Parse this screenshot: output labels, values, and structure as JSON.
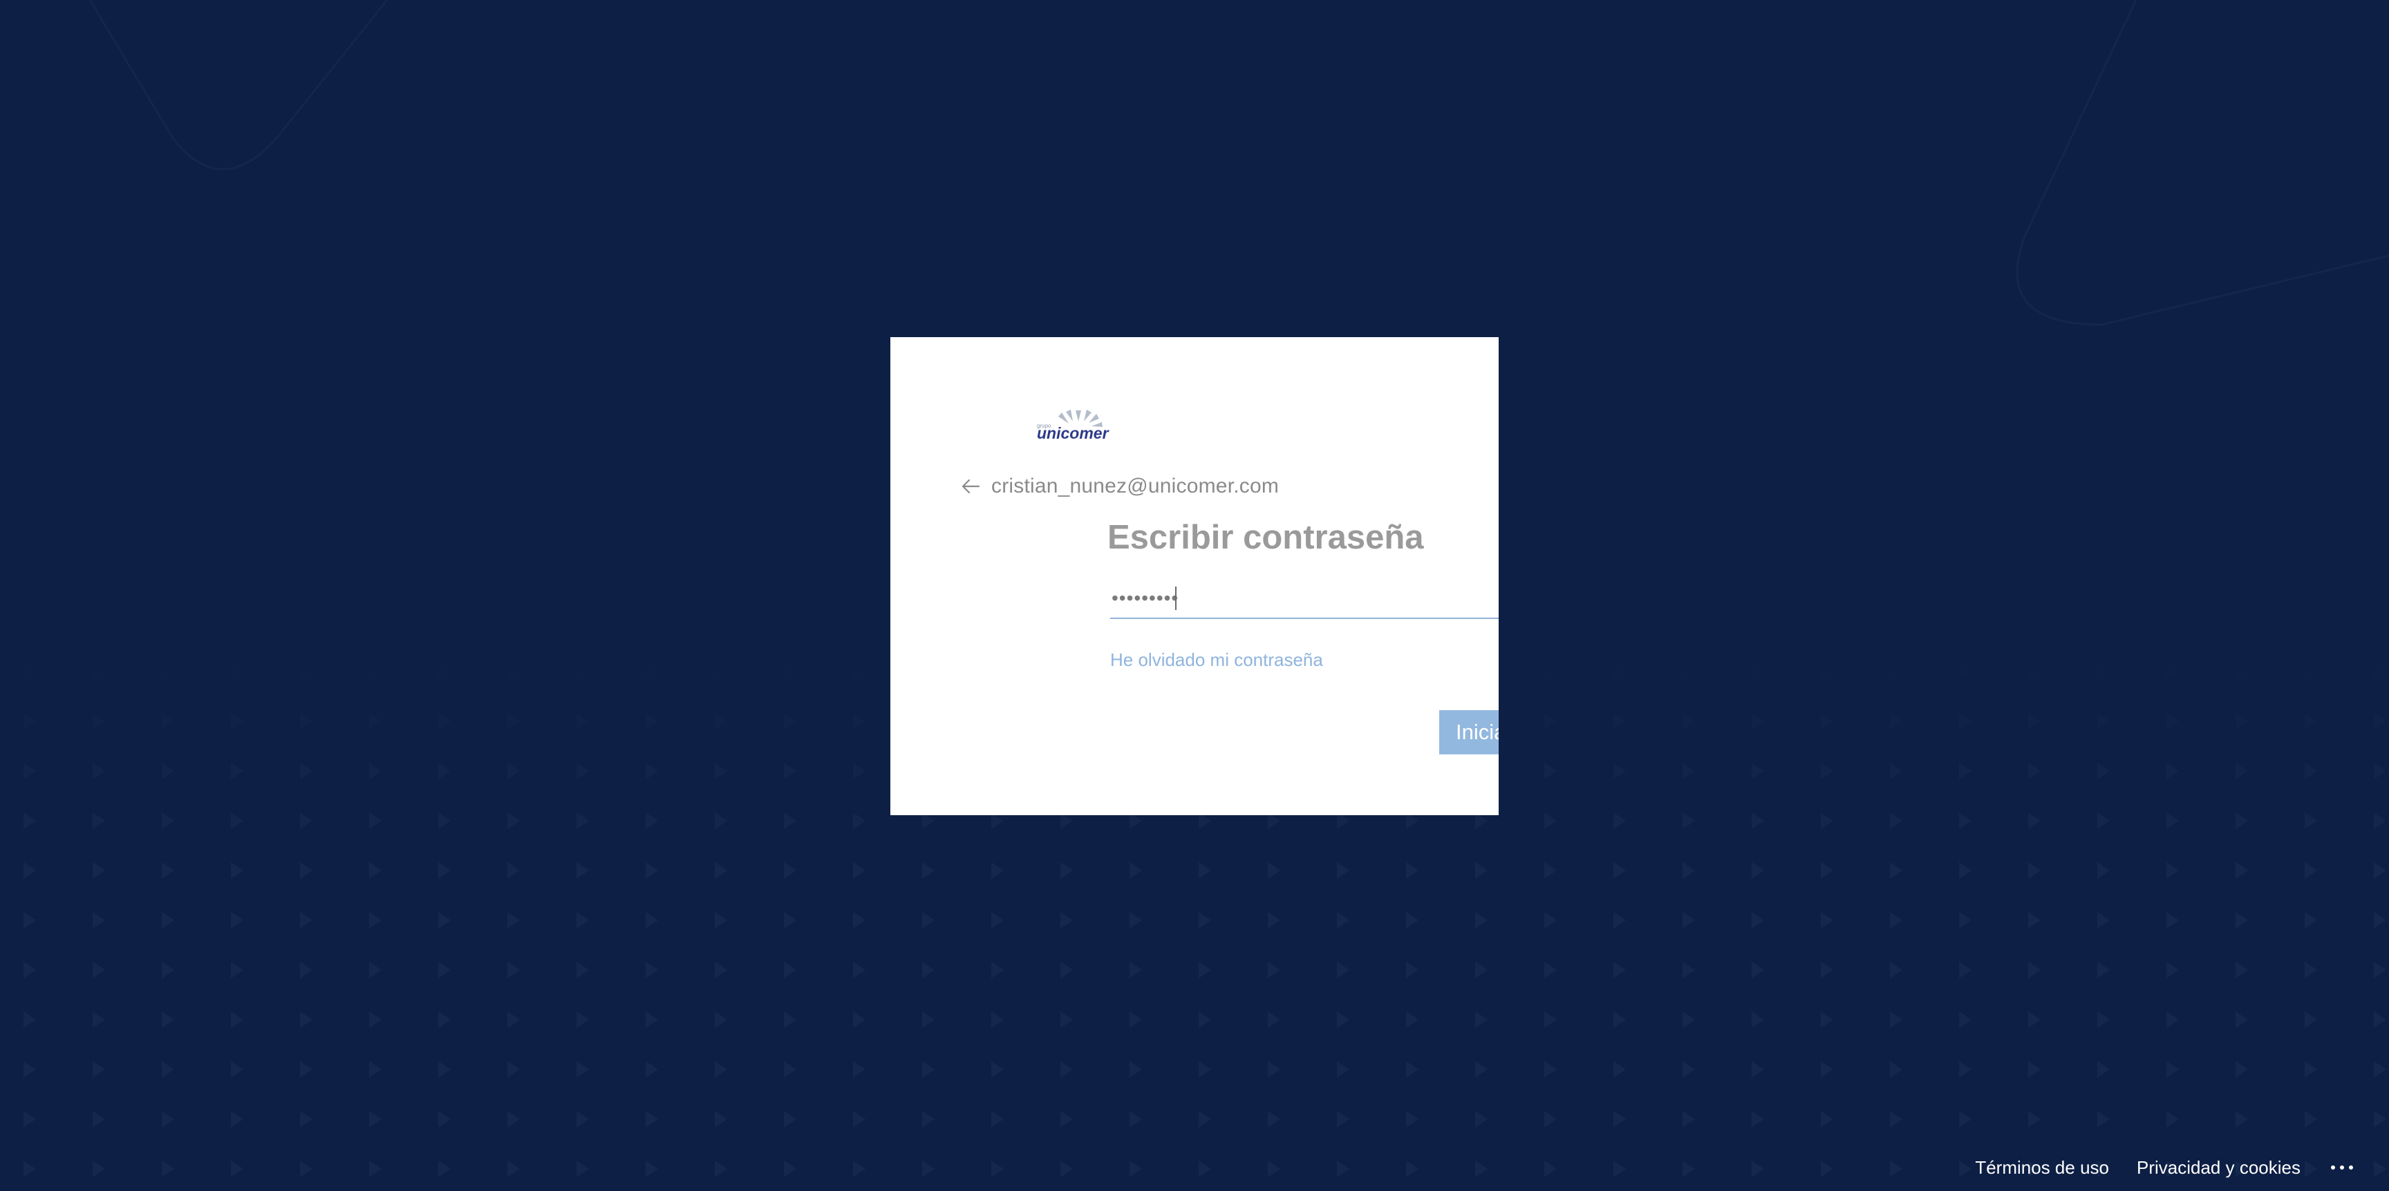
{
  "page": {
    "background_color": "#0e1f45"
  },
  "card": {
    "logo_text": "unicomer",
    "identity_email": "cristian_nunez@unicomer.com",
    "title": "Escribir contraseña",
    "password_value": "•••••••••",
    "forgot_link": "He olvidado mi contraseña",
    "signin_button": "Iniciar sesión"
  },
  "footer": {
    "terms_label": "Términos de uso",
    "privacy_label": "Privacidad y cookies",
    "more_label": "..."
  },
  "colors": {
    "accent": "#93b8df",
    "link": "#8fb4de",
    "title_text": "#9a9a9a"
  },
  "icons": {
    "back": "arrow-left-icon",
    "more": "ellipsis-icon",
    "logo": "unicomer-logo"
  }
}
